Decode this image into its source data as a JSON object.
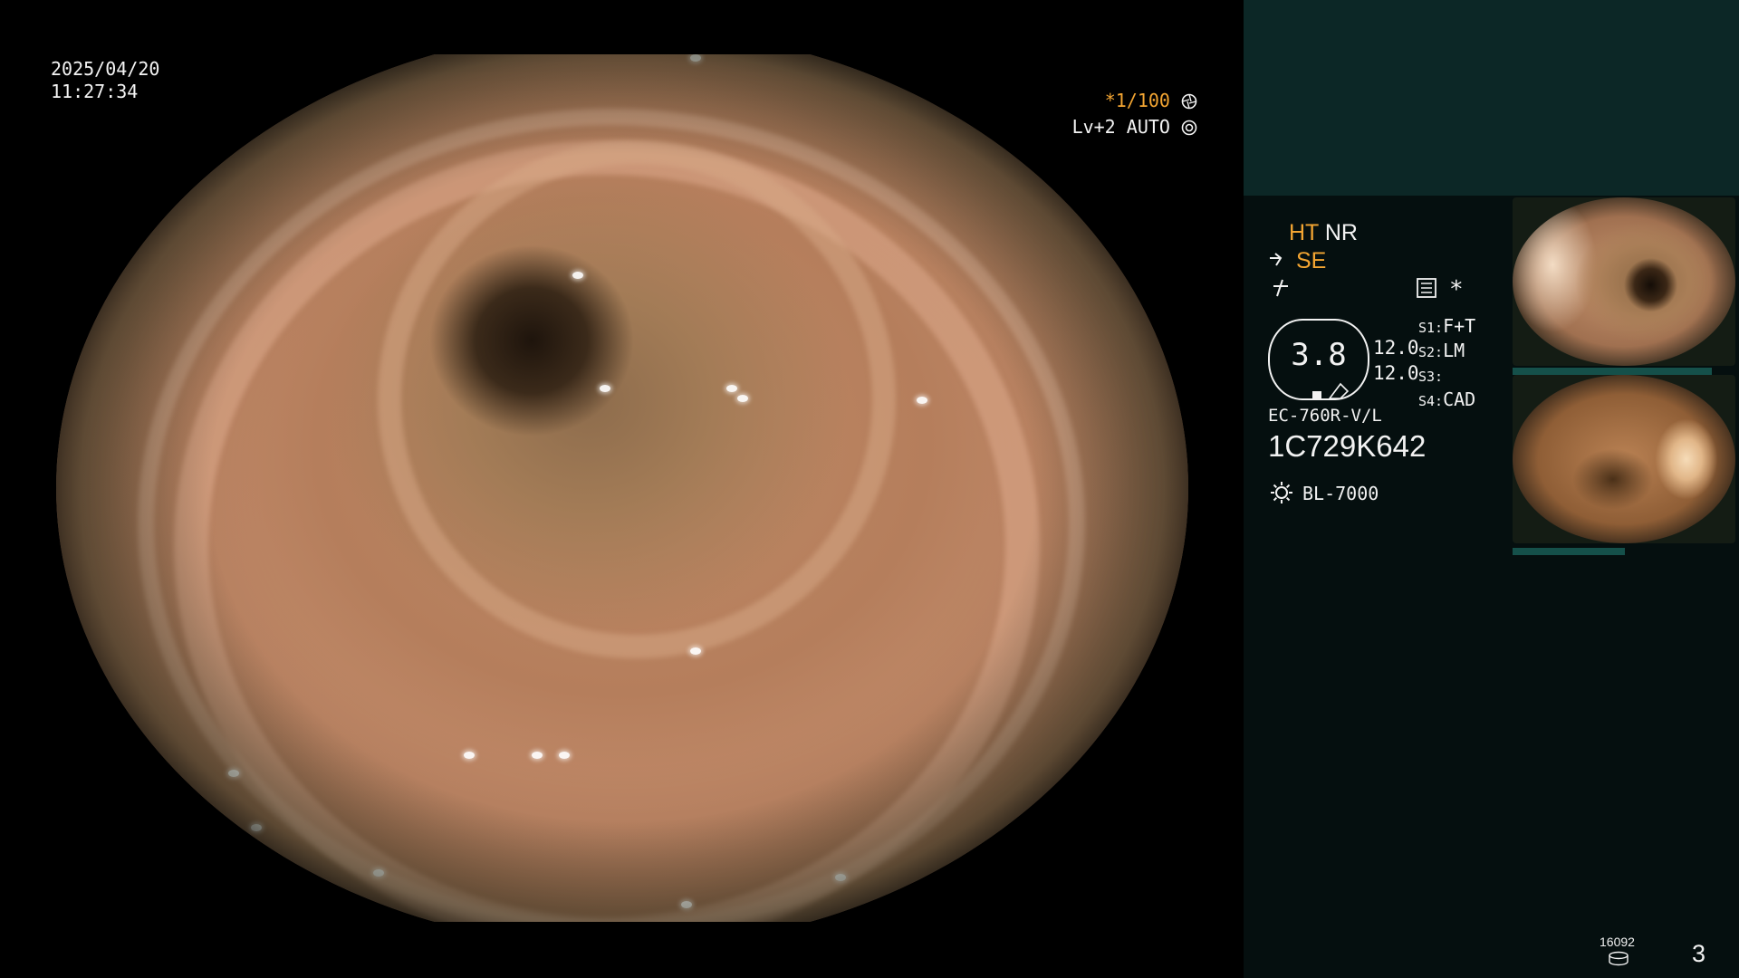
{
  "overlay": {
    "date": "2025/04/20",
    "time": "11:27:34",
    "shutter": "*1/100",
    "shutter_icon": "aperture-icon",
    "level": "Lv+2",
    "level_mode": "AUTO",
    "level_icon": "ring-icon"
  },
  "panel": {
    "mode_ht": "HT",
    "mode_nr": "NR",
    "mode_se": "SE",
    "se_icon": "scope-angle-icon",
    "freeze_icon": "slash-icon",
    "settings_icon": "settings-list-icon",
    "asterisk": "*",
    "gauge_value": "3.8",
    "val_a": "12.0",
    "val_b": "12.0",
    "switches": [
      {
        "key": "S1:",
        "value": "F+T"
      },
      {
        "key": "S2:",
        "value": "LM"
      },
      {
        "key": "S3:",
        "value": ""
      },
      {
        "key": "S4:",
        "value": "CAD"
      }
    ],
    "scope_model": "EC-760R-V/L",
    "serial": "1C729K642",
    "light_icon": "lamp-icon",
    "light_source": "BL-7000",
    "counter": "16092",
    "disk_icon": "disk-icon",
    "page": "3"
  },
  "colors": {
    "accent_orange": "#f3a532",
    "panel_top": "#0c2726",
    "panel_body": "#050f0f",
    "thumb_bar": "#15504a"
  }
}
